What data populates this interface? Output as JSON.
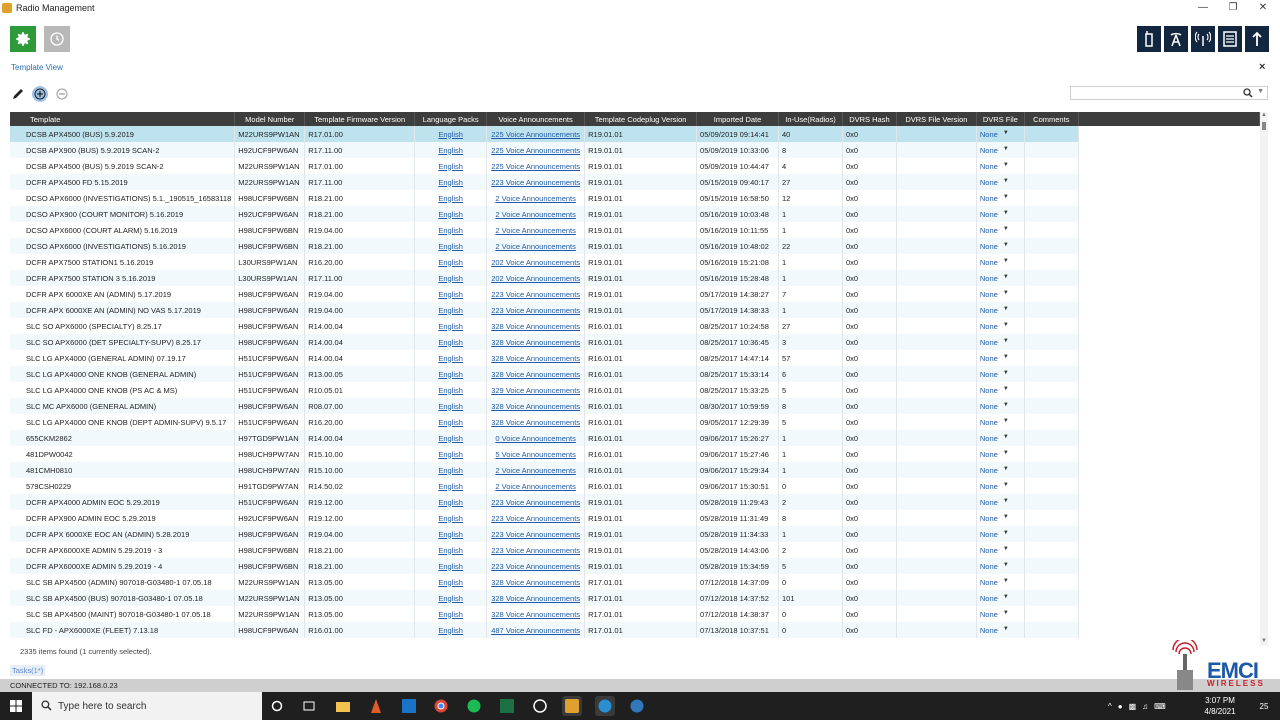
{
  "window": {
    "title": "Radio Management"
  },
  "view": {
    "title": "Template View",
    "close": "×"
  },
  "search": {
    "placeholder": ""
  },
  "columns": [
    "Template",
    "Model Number",
    "Template Firmware Version",
    "Language Packs",
    "Voice Announcements",
    "Template Codeplug Version",
    "Imported Date",
    "In-Use(Radios)",
    "DVRS Hash",
    "DVRS File Version",
    "DVRS File",
    "Comments"
  ],
  "rows": [
    [
      "DCSB APX4500 (BUS) 5.9.2019",
      "M22URS9PW1AN",
      "R17.01.00",
      "English",
      "225 Voice Announcements",
      "R19.01.01",
      "05/09/2019 09:14:41",
      "40",
      "0x0",
      "",
      "None",
      ""
    ],
    [
      "DCSB APX900 (BUS) 5.9.2019 SCAN-2",
      "H92UCF9PW6AN",
      "R17.11.00",
      "English",
      "225 Voice Announcements",
      "R19.01.01",
      "05/09/2019 10:33:06",
      "8",
      "0x0",
      "",
      "None",
      ""
    ],
    [
      "DCSB APX4500 (BUS) 5.9.2019 SCAN-2",
      "M22URS9PW1AN",
      "R17.01.00",
      "English",
      "225 Voice Announcements",
      "R19.01.01",
      "05/09/2019 10:44:47",
      "4",
      "0x0",
      "",
      "None",
      ""
    ],
    [
      "DCFR APX4500 FD 5.15.2019",
      "M22URS9PW1AN",
      "R17.11.00",
      "English",
      "223 Voice Announcements",
      "R19.01.01",
      "05/15/2019 09:40:17",
      "27",
      "0x0",
      "",
      "None",
      ""
    ],
    [
      "DCSO APX6000 (INVESTIGATIONS) 5.1._190515_16583118",
      "H98UCF9PW6BN",
      "R18.21.00",
      "English",
      "2 Voice Announcements",
      "R19.01.01",
      "05/15/2019 16:58:50",
      "12",
      "0x0",
      "",
      "None",
      ""
    ],
    [
      "DCSO APX900 (COURT MONITOR) 5.16.2019",
      "H92UCF9PW6AN",
      "R18.21.00",
      "English",
      "2 Voice Announcements",
      "R19.01.01",
      "05/16/2019 10:03:48",
      "1",
      "0x0",
      "",
      "None",
      ""
    ],
    [
      "DCSO APX6000 (COURT ALARM) 5.16.2019",
      "H98UCF9PW6BN",
      "R19.04.00",
      "English",
      "2 Voice Announcements",
      "R19.01.01",
      "05/16/2019 10:11:55",
      "1",
      "0x0",
      "",
      "None",
      ""
    ],
    [
      "DCSO APX6000 (INVESTIGATIONS) 5.16.2019",
      "H98UCF9PW6BN",
      "R18.21.00",
      "English",
      "2 Voice Announcements",
      "R19.01.01",
      "05/16/2019 10:48:02",
      "22",
      "0x0",
      "",
      "None",
      ""
    ],
    [
      "DCFR APX7500 STATION1 5.16.2019",
      "L30URS9PW1AN",
      "R16.20.00",
      "English",
      "202 Voice Announcements",
      "R19.01.01",
      "05/16/2019 15:21:08",
      "1",
      "0x0",
      "",
      "None",
      ""
    ],
    [
      "DCFR APX7500 STATION 3 5.16.2019",
      "L30URS9PW1AN",
      "R17.11.00",
      "English",
      "202 Voice Announcements",
      "R19.01.01",
      "05/16/2019 15:28:48",
      "1",
      "0x0",
      "",
      "None",
      ""
    ],
    [
      "DCFR APX 6000XE AN (ADMIN) 5.17.2019",
      "H98UCF9PW6AN",
      "R19.04.00",
      "English",
      "223 Voice Announcements",
      "R19.01.01",
      "05/17/2019 14:38:27",
      "7",
      "0x0",
      "",
      "None",
      ""
    ],
    [
      "DCFR APX 6000XE AN (ADMIN) NO VAS 5.17.2019",
      "H98UCF9PW6AN",
      "R19.04.00",
      "English",
      "223 Voice Announcements",
      "R19.01.01",
      "05/17/2019 14:38:33",
      "1",
      "0x0",
      "",
      "None",
      ""
    ],
    [
      "SLC SO APX6000 (SPECIALTY) 8.25.17",
      "H98UCF9PW6AN",
      "R14.00.04",
      "English",
      "328 Voice Announcements",
      "R16.01.01",
      "08/25/2017 10:24:58",
      "27",
      "0x0",
      "",
      "None",
      ""
    ],
    [
      "SLC SO APX6000 (DET SPECIALTY-SUPV) 8.25.17",
      "H98UCF9PW6AN",
      "R14.00.04",
      "English",
      "328 Voice Announcements",
      "R16.01.01",
      "08/25/2017 10:36:45",
      "3",
      "0x0",
      "",
      "None",
      ""
    ],
    [
      "SLC LG APX4000 (GENERAL ADMIN) 07.19.17",
      "H51UCF9PW6AN",
      "R14.00.04",
      "English",
      "328 Voice Announcements",
      "R16.01.01",
      "08/25/2017 14:47:14",
      "57",
      "0x0",
      "",
      "None",
      ""
    ],
    [
      "SLC LG APX4000 ONE KNOB (GENERAL ADMIN)",
      "H51UCF9PW6AN",
      "R13.00.05",
      "English",
      "328 Voice Announcements",
      "R16.01.01",
      "08/25/2017 15:33:14",
      "6",
      "0x0",
      "",
      "None",
      ""
    ],
    [
      "SLC LG APX4000 ONE KNOB (PS AC & MS)",
      "H51UCF9PW6AN",
      "R10.05.01",
      "English",
      "329 Voice Announcements",
      "R16.01.01",
      "08/25/2017 15:33:25",
      "5",
      "0x0",
      "",
      "None",
      ""
    ],
    [
      "SLC MC APX6000 (GENERAL ADMIN)",
      "H98UCF9PW6AN",
      "R08.07.00",
      "English",
      "328 Voice Announcements",
      "R16.01.01",
      "08/30/2017 10:59:59",
      "8",
      "0x0",
      "",
      "None",
      ""
    ],
    [
      "SLC LG APX4000 ONE KNOB (DEPT ADMIN-SUPV) 9.5.17",
      "H51UCF9PW6AN",
      "R16.20.00",
      "English",
      "328 Voice Announcements",
      "R16.01.01",
      "09/05/2017 12:29:39",
      "5",
      "0x0",
      "",
      "None",
      ""
    ],
    [
      "655CKM2862",
      "H97TGD9PW1AN",
      "R14.00.04",
      "English",
      "0 Voice Announcements",
      "R16.01.01",
      "09/06/2017 15:26:27",
      "1",
      "0x0",
      "",
      "None",
      ""
    ],
    [
      "481DPW0042",
      "H98UCH9PW7AN",
      "R15.10.00",
      "English",
      "5 Voice Announcements",
      "R16.01.01",
      "09/06/2017 15:27:46",
      "1",
      "0x0",
      "",
      "None",
      ""
    ],
    [
      "481CMH0810",
      "H98UCH9PW7AN",
      "R15.10.00",
      "English",
      "2 Voice Announcements",
      "R16.01.01",
      "09/06/2017 15:29:34",
      "1",
      "0x0",
      "",
      "None",
      ""
    ],
    [
      "579CSH0229",
      "H91TGD9PW7AN",
      "R14.50.02",
      "English",
      "2 Voice Announcements",
      "R16.01.01",
      "09/06/2017 15:30:51",
      "0",
      "0x0",
      "",
      "None",
      ""
    ],
    [
      "DCFR APX4000 ADMIN EOC 5.29.2019",
      "H51UCF9PW6AN",
      "R19.12.00",
      "English",
      "223 Voice Announcements",
      "R19.01.01",
      "05/28/2019 11:29:43",
      "2",
      "0x0",
      "",
      "None",
      ""
    ],
    [
      "DCFR APX900 ADMIN EOC 5.29.2019",
      "H92UCF9PW6AN",
      "R19.12.00",
      "English",
      "223 Voice Announcements",
      "R19.01.01",
      "05/28/2019 11:31:49",
      "8",
      "0x0",
      "",
      "None",
      ""
    ],
    [
      "DCFR APX 6000XE EOC AN (ADMIN) 5.28.2019",
      "H98UCF9PW6AN",
      "R19.04.00",
      "English",
      "223 Voice Announcements",
      "R19.01.01",
      "05/28/2019 11:34:33",
      "1",
      "0x0",
      "",
      "None",
      ""
    ],
    [
      "DCFR APX6000XE ADMIN 5.29.2019 - 3",
      "H98UCF9PW6BN",
      "R18.21.00",
      "English",
      "223 Voice Announcements",
      "R19.01.01",
      "05/28/2019 14:43:06",
      "2",
      "0x0",
      "",
      "None",
      ""
    ],
    [
      "DCFR APX6000XE ADMIN 5.29.2019 - 4",
      "H98UCF9PW6BN",
      "R18.21.00",
      "English",
      "223 Voice Announcements",
      "R19.01.01",
      "05/28/2019 15:34:59",
      "5",
      "0x0",
      "",
      "None",
      ""
    ],
    [
      "SLC SB APX4500 (ADMIN) 907018-G03480-1 07.05.18",
      "M22URS9PW1AN",
      "R13.05.00",
      "English",
      "328 Voice Announcements",
      "R17.01.01",
      "07/12/2018 14:37:09",
      "0",
      "0x0",
      "",
      "None",
      ""
    ],
    [
      "SLC SB APX4500 (BUS) 907018-G03480-1 07.05.18",
      "M22URS9PW1AN",
      "R13.05.00",
      "English",
      "328 Voice Announcements",
      "R17.01.01",
      "07/12/2018 14:37:52",
      "101",
      "0x0",
      "",
      "None",
      ""
    ],
    [
      "SLC SB APX4500 (MAINT) 907018-G03480-1 07.05.18",
      "M22URS9PW1AN",
      "R13.05.00",
      "English",
      "328 Voice Announcements",
      "R17.01.01",
      "07/12/2018 14:38:37",
      "0",
      "0x0",
      "",
      "None",
      ""
    ],
    [
      "SLC FD - APX6000XE (FLEET) 7.13.18",
      "H98UCF9PW6AN",
      "R16.01.00",
      "English",
      "487 Voice Announcements",
      "R17.01.01",
      "07/13/2018 10:37:51",
      "0",
      "0x0",
      "",
      "None",
      ""
    ]
  ],
  "footer": {
    "items_found": "2335 items found (1 currently selected).",
    "tasks": "Tasks(1*)",
    "connected": "CONNECTED TO: 192.168.0.23"
  },
  "logo": {
    "name": "EMCI",
    "tagline": "WIRELESS"
  },
  "taskbar": {
    "search_placeholder": "Type here to search",
    "time": "3:07 PM",
    "date": "4/8/2021",
    "notifications": "25"
  },
  "colors": {
    "header_bg": "#3d3d3d",
    "selected_row": "#bfe3ee",
    "alt_row": "#f1f9fc",
    "gear_green": "#2e9a3a",
    "nav_dark": "#12263f",
    "link_blue": "#1f5ba8"
  }
}
